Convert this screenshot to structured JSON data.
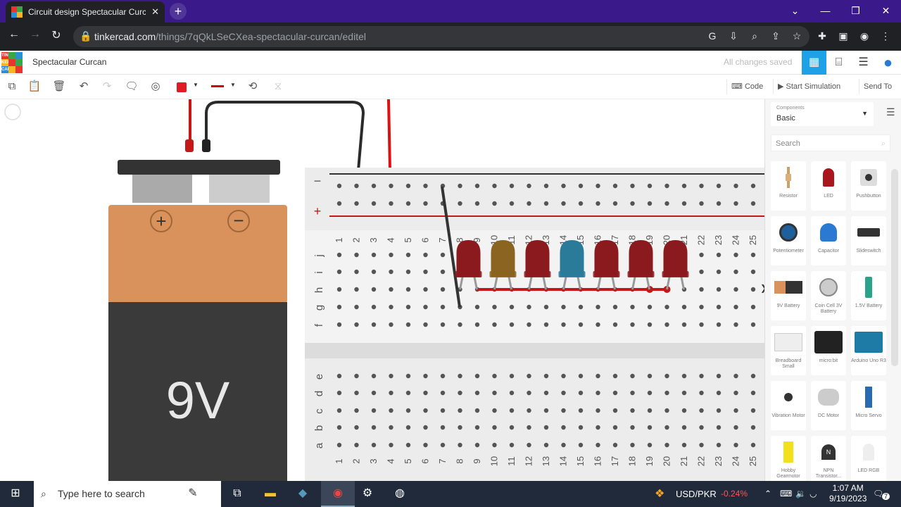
{
  "browser": {
    "tab_title": "Circuit design Spectacular Curca",
    "url_host": "tinkercad.com",
    "url_path": "/things/7qQkLSeCXea-spectacular-curcan/editel"
  },
  "app": {
    "logo_letters": [
      "TIN",
      "KER",
      "CAD"
    ],
    "project_name": "Spectacular Curcan",
    "save_status": "All changes saved"
  },
  "toolbar": {
    "code_label": "Code",
    "start_sim_label": "Start Simulation",
    "send_to_label": "Send To",
    "fill_color": "#e01b24"
  },
  "battery": {
    "label": "9V",
    "plus": "+",
    "minus": "−"
  },
  "breadboard": {
    "rail_minus": "−",
    "rail_plus": "+",
    "upper_rows": [
      "j",
      "i",
      "h",
      "g",
      "f"
    ],
    "lower_rows": [
      "e",
      "d",
      "c",
      "b",
      "a"
    ],
    "columns": [
      "1",
      "2",
      "3",
      "4",
      "5",
      "6",
      "7",
      "8",
      "9",
      "10",
      "11",
      "12",
      "13",
      "14",
      "15",
      "16",
      "17",
      "18",
      "19",
      "20",
      "21",
      "22",
      "23",
      "24",
      "25"
    ],
    "leds": [
      {
        "col": 8,
        "color": "#8b1a1f"
      },
      {
        "col": 10,
        "color": "#8a6420"
      },
      {
        "col": 12,
        "color": "#8b1a1f"
      },
      {
        "col": 14,
        "color": "#2a7a9a"
      },
      {
        "col": 16,
        "color": "#8b1a1f"
      },
      {
        "col": 18,
        "color": "#8b1a1f"
      },
      {
        "col": 20,
        "color": "#8b1a1f"
      }
    ]
  },
  "panel": {
    "components_caption": "Components",
    "components_value": "Basic",
    "search_placeholder": "Search",
    "items": [
      {
        "label": "Resistor",
        "icon": "resistor-icon"
      },
      {
        "label": "LED",
        "icon": "led-icon"
      },
      {
        "label": "Pushbutton",
        "icon": "pushbutton-icon"
      },
      {
        "label": "Potentiometer",
        "icon": "potentiometer-icon"
      },
      {
        "label": "Capacitor",
        "icon": "capacitor-icon"
      },
      {
        "label": "Slideswitch",
        "icon": "slideswitch-icon"
      },
      {
        "label": "9V Battery",
        "icon": "battery-9v-icon"
      },
      {
        "label": "Coin Cell 3V Battery",
        "icon": "coin-cell-icon"
      },
      {
        "label": "1.5V Battery",
        "icon": "battery-aa-icon"
      },
      {
        "label": "Breadboard Small",
        "icon": "breadboard-icon"
      },
      {
        "label": "micro:bit",
        "icon": "microbit-icon"
      },
      {
        "label": "Arduino Uno R3",
        "icon": "arduino-icon"
      },
      {
        "label": "Vibration Motor",
        "icon": "vibration-motor-icon"
      },
      {
        "label": "DC Motor",
        "icon": "dc-motor-icon"
      },
      {
        "label": "Micro Servo",
        "icon": "servo-icon"
      },
      {
        "label": "Hobby Gearmotor",
        "icon": "gearmotor-icon"
      },
      {
        "label": "NPN Transistor...",
        "icon": "transistor-icon"
      },
      {
        "label": "LED RGB",
        "icon": "rgb-led-icon"
      }
    ]
  },
  "taskbar": {
    "search_placeholder": "Type here to search",
    "currency": "USD/PKR",
    "change": "-0.24%",
    "time": "1:07 AM",
    "date": "9/19/2023",
    "notifications": "7"
  }
}
